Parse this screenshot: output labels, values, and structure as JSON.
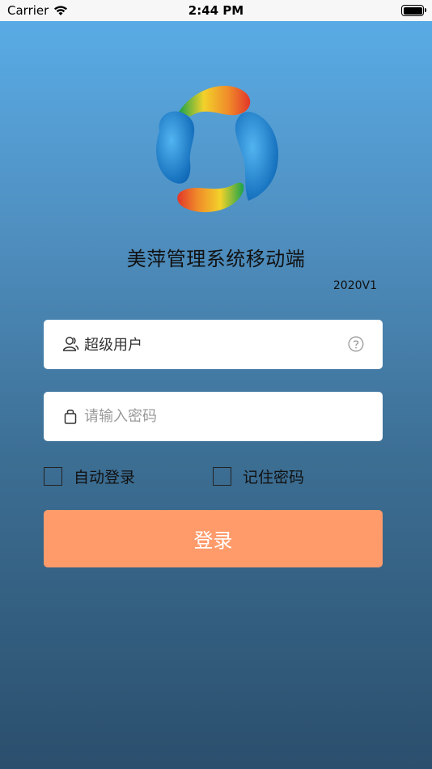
{
  "status_bar": {
    "carrier": "Carrier",
    "time": "2:44 PM"
  },
  "app": {
    "title": "美萍管理系统移动端",
    "version": "2020V1"
  },
  "login_form": {
    "username_value": "超级用户",
    "password_placeholder": "请输入密码",
    "auto_login_label": "自动登录",
    "remember_password_label": "记住密码",
    "login_button_label": "登录"
  },
  "colors": {
    "button": "#ff9b6b",
    "background_top": "#5aaee9",
    "background_bottom": "#2b4f6d"
  },
  "icons": [
    "wifi-icon",
    "battery-icon",
    "app-logo",
    "user-icon",
    "help-icon",
    "lock-icon"
  ]
}
